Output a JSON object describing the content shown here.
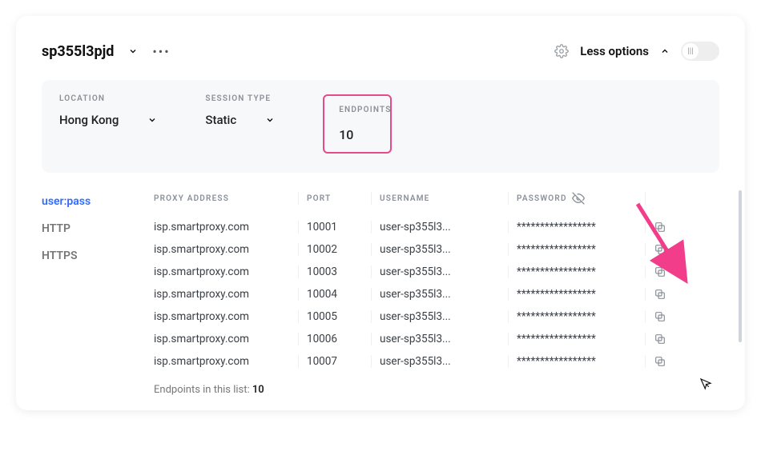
{
  "header": {
    "title": "sp355l3pjd",
    "less_options": "Less options"
  },
  "filters": {
    "location_label": "LOCATION",
    "location_value": "Hong Kong",
    "session_label": "SESSION TYPE",
    "session_value": "Static",
    "endpoints_label": "ENDPOINTS",
    "endpoints_value": "10"
  },
  "tabs": {
    "userpass": "user:pass",
    "http": "HTTP",
    "https": "HTTPS"
  },
  "columns": {
    "addr": "PROXY ADDRESS",
    "port": "PORT",
    "user": "USERNAME",
    "pass": "PASSWORD"
  },
  "rows": [
    {
      "addr": "isp.smartproxy.com",
      "port": "10001",
      "user": "user-sp355l3...",
      "pass": "*****************"
    },
    {
      "addr": "isp.smartproxy.com",
      "port": "10002",
      "user": "user-sp355l3...",
      "pass": "*****************"
    },
    {
      "addr": "isp.smartproxy.com",
      "port": "10003",
      "user": "user-sp355l3...",
      "pass": "*****************"
    },
    {
      "addr": "isp.smartproxy.com",
      "port": "10004",
      "user": "user-sp355l3...",
      "pass": "*****************"
    },
    {
      "addr": "isp.smartproxy.com",
      "port": "10005",
      "user": "user-sp355l3...",
      "pass": "*****************"
    },
    {
      "addr": "isp.smartproxy.com",
      "port": "10006",
      "user": "user-sp355l3...",
      "pass": "*****************"
    },
    {
      "addr": "isp.smartproxy.com",
      "port": "10007",
      "user": "user-sp355l3...",
      "pass": "*****************"
    }
  ],
  "footer": {
    "label": "Endpoints in this list: ",
    "count": "10"
  }
}
